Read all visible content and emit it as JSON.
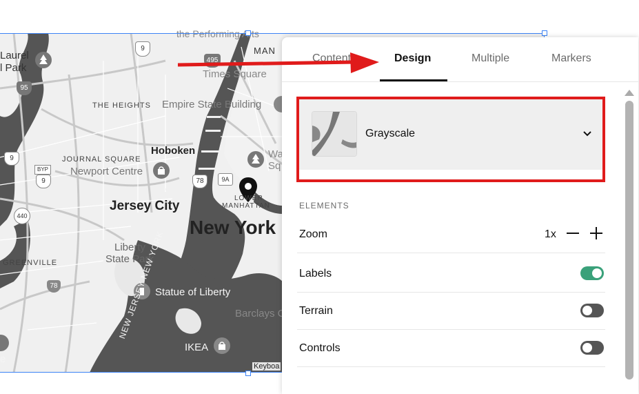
{
  "map": {
    "labels": {
      "laurel_park": "Laurel",
      "laurel_park_2": "l Park",
      "the_heights": "THE HEIGHTS",
      "empire_state": "Empire State Building",
      "times_square": "Times Square",
      "hoboken": "Hoboken",
      "journal_square": "JOURNAL SQUARE",
      "newport_centre": "Newport Centre",
      "jersey_city": "Jersey City",
      "lower_manhattan_1": "LOWER",
      "lower_manhattan_2": "MANHATTAN",
      "new_york": "New York",
      "liberty_state_park_1": "Liberty",
      "liberty_state_park_2": "State Park",
      "greenville": "GREENVILLE",
      "statue_of_liberty": "Statue of Liberty",
      "barclays": "Barclays Cen",
      "ikea": "IKEA",
      "new_jersey_ny": "NEW JERSEY NEW YORK",
      "performing_arts": "the Performing Arts",
      "wa_sq_1": "Wa",
      "wa_sq_2": "Sq",
      "man": "MAN",
      "e_label": "e"
    },
    "shields": {
      "r9_top": "9",
      "r95": "95",
      "r495": "495",
      "r9_left": "9",
      "byp": "BYP",
      "r9_byp": "9",
      "r78": "78",
      "r9a": "9A",
      "r440": "440",
      "r78b": "78"
    },
    "attribution": "Keyboa",
    "colors": {
      "water": "#555555",
      "land": "#f0f0f0",
      "selection": "#3b82f6",
      "red": "#e01b1b"
    }
  },
  "panel": {
    "tabs": [
      "Content",
      "Design",
      "Multiple",
      "Markers"
    ],
    "active_tab": "Design",
    "style": {
      "selected": "Grayscale"
    },
    "section_title": "ELEMENTS",
    "zoom": {
      "label": "Zoom",
      "value": "1x"
    },
    "toggles": [
      {
        "label": "Labels",
        "state": "on"
      },
      {
        "label": "Terrain",
        "state": "off"
      },
      {
        "label": "Controls",
        "state": "off"
      }
    ],
    "colors": {
      "toggle_on": "#3aa17a",
      "toggle_off": "#555555"
    }
  }
}
